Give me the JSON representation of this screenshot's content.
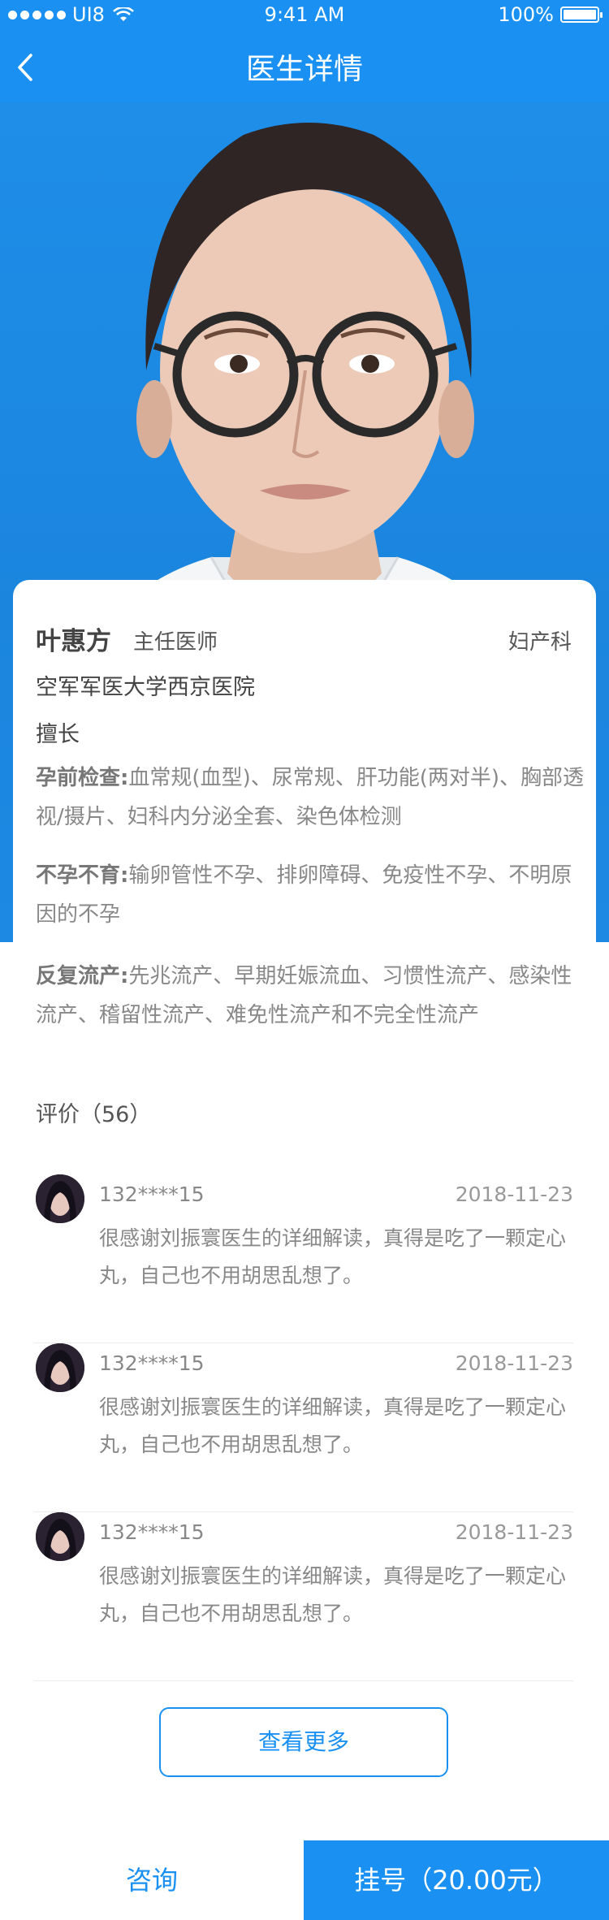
{
  "status_bar": {
    "carrier": "UI8",
    "time": "9:41 AM",
    "battery_percent": "100%"
  },
  "nav": {
    "title": "医生详情"
  },
  "doctor": {
    "name": "叶惠方",
    "title": "主任医师",
    "department": "妇产科",
    "hospital": "空军军医大学西京医院",
    "expertise_label": "擅长",
    "specialties": [
      {
        "key": "孕前检查",
        "colon": ":",
        "text": "血常规(血型)、尿常规、肝功能(两对半)、胸部透视/摄片、妇科内分泌全套、染色体检测"
      },
      {
        "key": "不孕不育",
        "colon": ":",
        "text": "输卵管性不孕、排卵障碍、免疫性不孕、不明原因的不孕"
      },
      {
        "key": "反复流产",
        "colon": ":",
        "text": "先兆流产、早期妊娠流血、习惯性流产、感染性流产、稽留性流产、难免性流产和不完全性流产"
      }
    ]
  },
  "reviews": {
    "title": "评价（56）",
    "items": [
      {
        "user": "132****15",
        "date": "2018-11-23",
        "text": "很感谢刘振寰医生的详细解读，真得是吃了一颗定心丸，自己也不用胡思乱想了。"
      },
      {
        "user": "132****15",
        "date": "2018-11-23",
        "text": "很感谢刘振寰医生的详细解读，真得是吃了一颗定心丸，自己也不用胡思乱想了。"
      },
      {
        "user": "132****15",
        "date": "2018-11-23",
        "text": "很感谢刘振寰医生的详细解读，真得是吃了一颗定心丸，自己也不用胡思乱想了。"
      }
    ],
    "more_label": "查看更多"
  },
  "bottom": {
    "consult_label": "咨询",
    "book_label": "挂号（20.00元）"
  },
  "colors": {
    "primary": "#1a91f2",
    "photo_bg": "#1e8ee8"
  }
}
